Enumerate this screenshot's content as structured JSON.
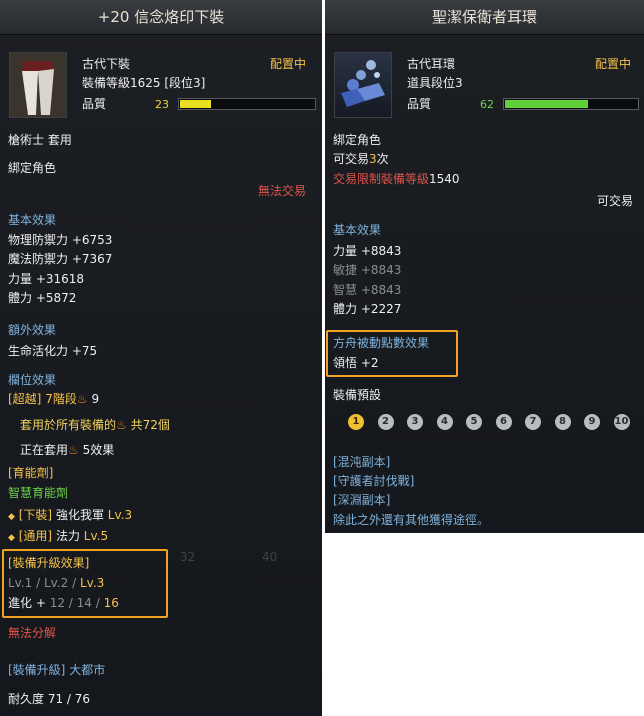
{
  "left": {
    "title": "+20 信念烙印下裝",
    "item_type": "古代下裝",
    "item_level": "裝備等級1625 [段位3]",
    "equipped_status": "配置中",
    "quality_label": "品質",
    "quality_value": "23",
    "quality_pct": 23,
    "class_req": "槍術士 套用",
    "bind_text": "綁定角色",
    "trade_status": "無法交易",
    "basic_effects_title": "基本效果",
    "basic_effects": [
      "物理防禦力 +6753",
      "魔法防禦力 +7367",
      "力量 +31618",
      "體力 +5872"
    ],
    "extra_effects_title": "額外效果",
    "extra_effects": [
      "生命活化力 +75"
    ],
    "slot_effects_title": "欄位效果",
    "transcend_tag": "[超越]",
    "transcend_value": "7階段",
    "transcend_count": "9",
    "transcend_all": "套用於所有裝備的",
    "transcend_all_count": "共72個",
    "transcend_active": "正在套用",
    "transcend_active_count": "5效果",
    "elixir_title": "[育能劑]",
    "elixir_name": "智慧育能劑",
    "elixir_rows": [
      {
        "slot": "[下裝]",
        "name": "強化我軍",
        "lv": "Lv.3"
      },
      {
        "slot": "[通用]",
        "name": "法力",
        "lv": "Lv.5"
      }
    ],
    "upgrade_title": "[裝備升級效果]",
    "upgrade_levels": [
      "Lv.1",
      "Lv.2",
      "Lv.3"
    ],
    "upgrade_evo_label": "進化 +",
    "upgrade_evo_values": [
      "12",
      "14",
      "16"
    ],
    "cannot_decompose": "無法分解",
    "upgrade_tag": "[裝備升級]",
    "upgrade_place": "大都市",
    "durability": "耐久度 71 / 76",
    "bg_numbers": [
      "32",
      "40"
    ],
    "icons": {
      "transcend": "flame-icon",
      "elixir_bullet": "diamond-icon"
    }
  },
  "right": {
    "title": "聖潔保衛者耳環",
    "item_type": "古代耳環",
    "item_tier": "道具段位3",
    "equipped_status": "配置中",
    "quality_label": "品質",
    "quality_value": "62",
    "quality_pct": 62,
    "bind_text": "綁定角色",
    "trade_count_prefix": "可交易",
    "trade_count": "3",
    "trade_count_suffix": "次",
    "trade_limit_label": "交易限制裝備等級",
    "trade_limit_value": "1540",
    "tradeable": "可交易",
    "basic_effects_title": "基本效果",
    "stats": [
      {
        "text": "力量 +8843",
        "active": true
      },
      {
        "text": "敏捷 +8843",
        "active": false
      },
      {
        "text": "智慧 +8843",
        "active": false
      },
      {
        "text": "體力 +2227",
        "active": true
      }
    ],
    "ark_title": "方舟被動點數效果",
    "ark_value": "領悟 +2",
    "preset_title": "裝備預設",
    "preset_numbers": [
      "1",
      "2",
      "3",
      "4",
      "5",
      "6",
      "7",
      "8",
      "9",
      "10"
    ],
    "preset_active": 1,
    "sources": [
      "[混沌副本]",
      "[守護者討伐戰]",
      "[深淵副本]"
    ],
    "sources_note": "除此之外還有其他獲得途徑。"
  },
  "colors": {
    "blue": "#7fb2dc",
    "gold": "#f5c24a",
    "red": "#e0544a",
    "green": "#6fd14a",
    "highlight": "#f2a223",
    "quality_left": "#e8e020",
    "quality_right": "#5fd23a"
  }
}
